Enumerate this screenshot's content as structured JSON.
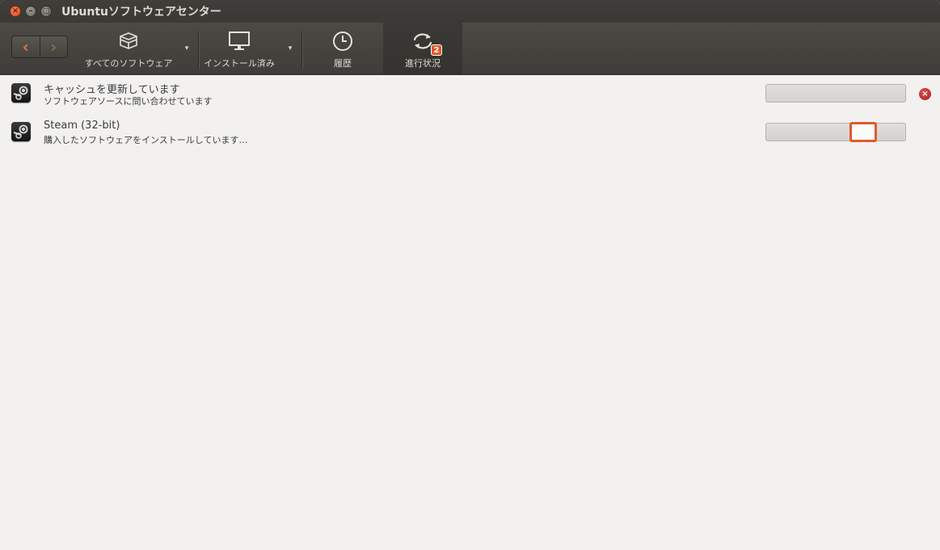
{
  "window": {
    "title": "Ubuntuソフトウェアセンター",
    "controls": {
      "close": "×",
      "minimize": "–",
      "maximize": "□"
    }
  },
  "toolbar": {
    "back_icon": "‹",
    "forward_icon": "›",
    "items": [
      {
        "label": "すべてのソフトウェア",
        "icon": "package-box-icon"
      },
      {
        "label": "インストール済み",
        "icon": "monitor-icon"
      },
      {
        "label": "履歴",
        "icon": "clock-icon"
      },
      {
        "label": "進行状況",
        "icon": "sync-icon",
        "badge": "2",
        "active": true
      }
    ],
    "dropdown_arrow": "▾"
  },
  "tasks": [
    {
      "title": "キャッシュを更新しています",
      "subtitle": "ソフトウェアソースに問い合わせています",
      "icon": "steam-icon",
      "cancel": "×"
    },
    {
      "title": "Steam (32-bit)",
      "subtitle": "購入したソフトウェアをインストールしています…",
      "icon": "steam-icon"
    }
  ],
  "colors": {
    "accent": "#e05a2b",
    "titlebar": "#3c3b37",
    "content_bg": "#f2f1f0"
  }
}
